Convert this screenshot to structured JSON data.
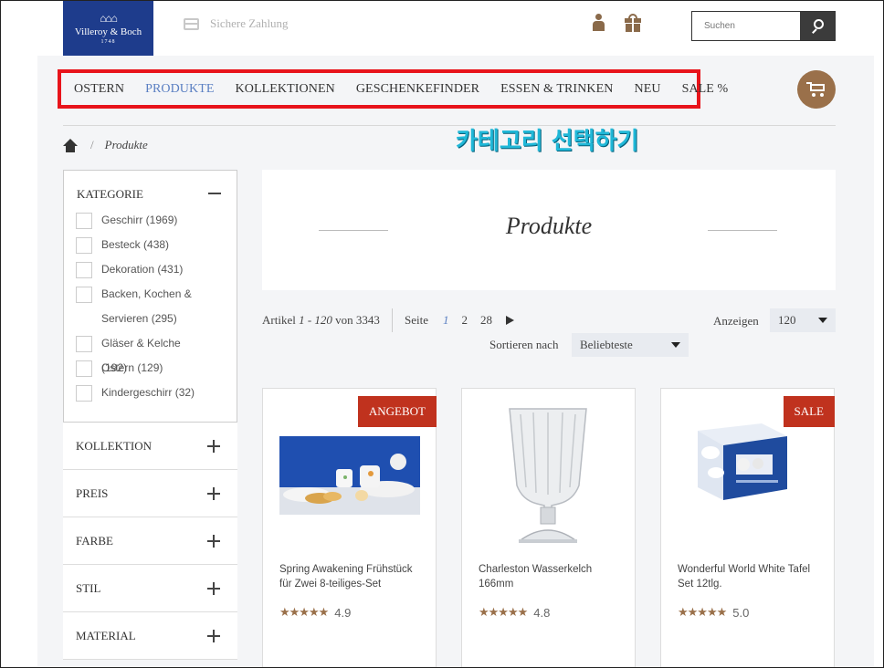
{
  "header": {
    "logo": {
      "brand": "Villeroy & Boch",
      "year": "1748"
    },
    "safe_payment": "Sichere Zahlung",
    "search": {
      "placeholder": "Suchen"
    },
    "icons": [
      "card-icon",
      "user-icon",
      "gift-icon",
      "search-icon",
      "cart-icon"
    ]
  },
  "nav": {
    "items": [
      {
        "label": "OSTERN",
        "active": false
      },
      {
        "label": "PRODUKTE",
        "active": true
      },
      {
        "label": "KOLLEKTIONEN",
        "active": false
      },
      {
        "label": "GESCHENKEFINDER",
        "active": false
      },
      {
        "label": "ESSEN & TRINKEN",
        "active": false
      },
      {
        "label": "NEU",
        "active": false
      },
      {
        "label": "SALE %",
        "active": false
      }
    ]
  },
  "annotation": "카테고리 선택하기",
  "breadcrumb": {
    "separator": "/",
    "current": "Produkte"
  },
  "sidebar": {
    "kategorie_title": "KATEGORIE",
    "kategorie_items": [
      "Geschirr (1969)",
      "Besteck (438)",
      "Dekoration (431)",
      "Backen, Kochen & Servieren (295)",
      "Gläser & Kelche (192)",
      "Ostern (129)",
      "Kindergeschirr (32)"
    ],
    "filters": [
      "KOLLEKTION",
      "PREIS",
      "FARBE",
      "STIL",
      "MATERIAL"
    ]
  },
  "hero": {
    "title": "Produkte"
  },
  "toolbar": {
    "articles_prefix": "Artikel",
    "articles_range": "1 - 120",
    "articles_of": "von",
    "articles_total": "3343",
    "page_label": "Seite",
    "pages": [
      "1",
      "2",
      "28"
    ],
    "current_page": "1",
    "show_label": "Anzeigen",
    "show_value": "120",
    "sort_label": "Sortieren nach",
    "sort_value": "Beliebteste"
  },
  "products": [
    {
      "name": "Spring Awakening Frühstück für Zwei 8-teiliges-Set",
      "badge": "ANGEBOT",
      "stars": "★★★★★",
      "score": "4.9"
    },
    {
      "name": "Charleston Wasserkelch 166mm",
      "badge": "",
      "stars": "★★★★★",
      "score": "4.8"
    },
    {
      "name": "Wonderful World White Tafel Set 12tlg.",
      "badge": "SALE",
      "stars": "★★★★★",
      "score": "5.0"
    }
  ],
  "colors": {
    "accent_blue": "#5a7fc2",
    "brand_brown": "#9a704a",
    "highlight_red": "#e8141b",
    "badge_red": "#c0321e",
    "logo_blue": "#1e3c8c",
    "annotation_cyan": "#20b8d8"
  }
}
